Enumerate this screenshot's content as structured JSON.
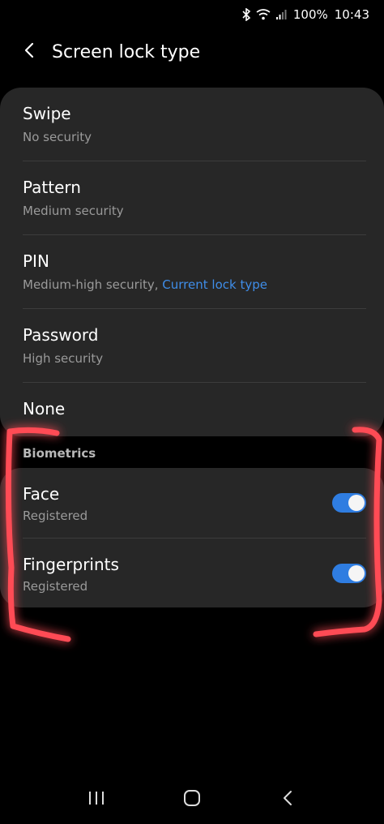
{
  "status": {
    "battery": "100%",
    "time": "10:43"
  },
  "header": {
    "title": "Screen lock type"
  },
  "lock_types": [
    {
      "title": "Swipe",
      "subtitle": "No security"
    },
    {
      "title": "Pattern",
      "subtitle": "Medium security"
    },
    {
      "title": "PIN",
      "subtitle": "Medium-high security, ",
      "current": "Current lock type"
    },
    {
      "title": "Password",
      "subtitle": "High security"
    },
    {
      "title": "None"
    }
  ],
  "biometrics": {
    "label": "Biometrics",
    "items": [
      {
        "title": "Face",
        "subtitle": "Registered",
        "enabled": true
      },
      {
        "title": "Fingerprints",
        "subtitle": "Registered",
        "enabled": true
      }
    ]
  },
  "colors": {
    "accent": "#3f8de8",
    "toggle_on": "#2f7de1",
    "annotation": "#ff4b55"
  },
  "icons": {
    "back": "chevron-left-icon",
    "bluetooth": "bluetooth-icon",
    "wifi": "wifi-icon",
    "signal": "signal-icon",
    "recents": "recents-icon",
    "home": "home-icon",
    "back_nav": "back-icon"
  }
}
